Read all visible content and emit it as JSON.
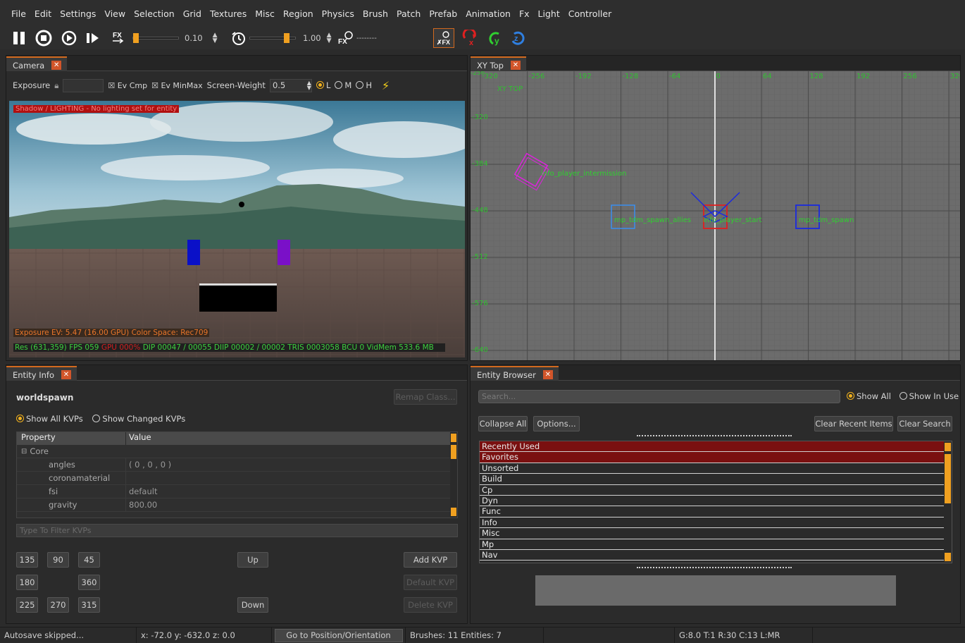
{
  "menu": [
    "File",
    "Edit",
    "Settings",
    "View",
    "Selection",
    "Grid",
    "Textures",
    "Misc",
    "Region",
    "Physics",
    "Brush",
    "Patch",
    "Prefab",
    "Animation",
    "Fx",
    "Light",
    "Controller"
  ],
  "toolbar": {
    "time_scale": "0.10",
    "timeofday_scale": "1.00",
    "fx_state": "--------"
  },
  "camera": {
    "tab": "Camera",
    "exposure_label": "Exposure",
    "ev_cmp": "Ev Cmp",
    "ev_minmax": "Ev MinMax",
    "screen_weight_label": "Screen-Weight",
    "screen_weight": "0.5",
    "quality_l": "L",
    "quality_m": "M",
    "quality_h": "H",
    "warning": "Shadow / LIGHTING - No lighting set for entity",
    "exposure_info": "Exposure EV: 5.47 (16.00 GPU)  Color Space: Rec709",
    "stats": {
      "res": "Res (631,359)",
      "fps": "FPS 059",
      "gpu": "GPU 000%",
      "dip": "DIP 00047 / 00055",
      "diip": "DIIP 00002 / 00002",
      "tris": "TRIS 0003058",
      "bcu": "BCU 0",
      "vidmem": "VidMem 533.6 MB"
    }
  },
  "xy_top": {
    "tab": "XY Top",
    "view_label": "XY TOP",
    "x_ticks": [
      "-320",
      "-256",
      "-192",
      "-128",
      "-64",
      "0",
      "64",
      "128",
      "192",
      "256",
      "320"
    ],
    "y_ticks": [
      "-320",
      "-384",
      "-448",
      "-512",
      "-576",
      "-640"
    ],
    "corner": "-256",
    "entity_labels": {
      "intermission": "info_player_intermission",
      "spawn_allies": "mp_tdm_spawn_allies",
      "player_start": "info_player_start",
      "spawn": "mp_tdm_spawn"
    }
  },
  "entity_info": {
    "tab": "Entity Info",
    "class_name": "worldspawn",
    "remap_class": "Remap Class...",
    "show_all": "Show All KVPs",
    "show_changed": "Show Changed KVPs",
    "col_property": "Property",
    "col_value": "Value",
    "group": "Core",
    "rows": [
      {
        "k": "angles",
        "v": "( 0 , 0 , 0 )"
      },
      {
        "k": "coronamaterial",
        "v": ""
      },
      {
        "k": "fsi",
        "v": "default"
      },
      {
        "k": "gravity",
        "v": "800.00"
      }
    ],
    "filter_placeholder": "Type To Filter KVPs",
    "angle_buttons": [
      "135",
      "90",
      "45",
      "180",
      "360",
      "225",
      "270",
      "315"
    ],
    "up": "Up",
    "down": "Down",
    "add_kvp": "Add KVP",
    "default_kvp": "Default KVP",
    "delete_kvp": "Delete KVP"
  },
  "entity_browser": {
    "tab": "Entity Browser",
    "search_placeholder": "Search...",
    "show_all": "Show All",
    "show_in_use": "Show In Use",
    "collapse_all": "Collapse All",
    "options": "Options...",
    "clear_recent": "Clear Recent Items",
    "clear_search": "Clear Search",
    "items": [
      "Recently Used",
      "Favorites",
      "Unsorted",
      "Build",
      "Cp",
      "Dyn",
      "Func",
      "Info",
      "Misc",
      "Mp",
      "Nav"
    ]
  },
  "status": {
    "autosave": "Autosave skipped...",
    "coords": "x: -72.0  y: -632.0  z: 0.0",
    "goto": "Go to Position/Orientation",
    "counts": "Brushes: 11 Entities: 7",
    "grid": "G:8.0 T:1 R:30 C:13 L:MR"
  },
  "colors": {
    "accent": "#d2691e",
    "selection_red": "#7a1010",
    "grid_bg": "#6e6e6e",
    "entity_green": "#3ecf3e"
  }
}
